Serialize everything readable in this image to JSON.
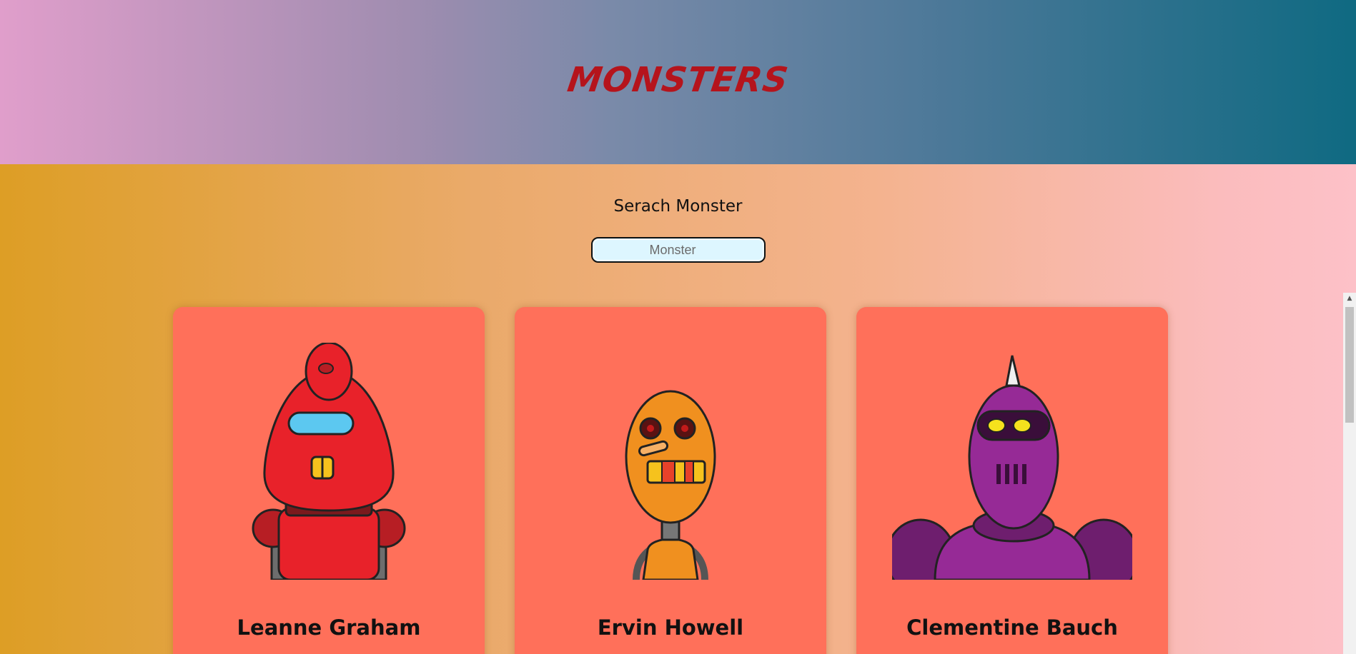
{
  "header": {
    "title": "MONSTERS"
  },
  "search": {
    "label": "Serach Monster",
    "placeholder": "Monster",
    "value": ""
  },
  "monsters": [
    {
      "name": "Leanne Graham",
      "robot_color": "#e8222a"
    },
    {
      "name": "Ervin Howell",
      "robot_color": "#f0901f"
    },
    {
      "name": "Clementine Bauch",
      "robot_color": "#8a2a8c"
    }
  ],
  "colors": {
    "card_background": "#ff705a",
    "title_color": "#b5141c",
    "input_background": "#ddf6ff"
  }
}
